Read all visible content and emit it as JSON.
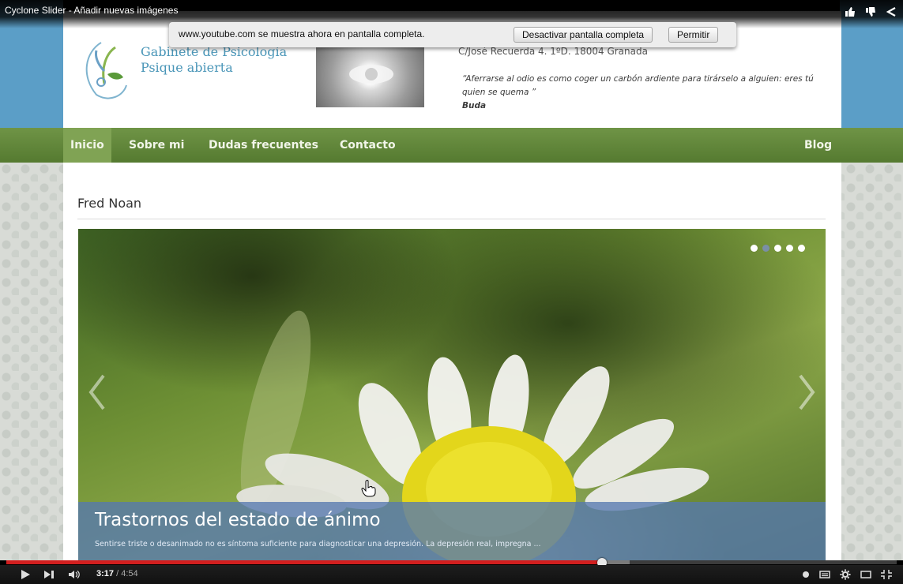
{
  "video": {
    "title": "Cyclone Slider - Añadir nuevas imágenes",
    "current_time": "3:17",
    "separator": "/",
    "duration": "4:54",
    "progress": 0.669,
    "loaded": 0.7
  },
  "fullscreen_notice": {
    "message": "www.youtube.com se muestra ahora en pantalla completa.",
    "exit_label": "Desactivar pantalla completa",
    "allow_label": "Permitir"
  },
  "site": {
    "logo_line1": "Gabinete de Psicología",
    "logo_line2": "Psique abierta",
    "address": "C/José Recuerda 4. 1ºD. 18004 Granada",
    "quote": "“Aferrarse al odio es como coger un carbón ardiente para tirárselo a alguien: eres tú quien se quema ”",
    "quote_author": "Buda"
  },
  "nav": {
    "items": [
      "Inicio",
      "Sobre mi",
      "Dudas frecuentes",
      "Contacto"
    ],
    "right_item": "Blog",
    "active_index": 0
  },
  "post": {
    "title": "Fred Noan"
  },
  "slider": {
    "caption_title": "Trastornos del estado de ánimo",
    "caption_text": "Sentirse triste o desanimado no es síntoma suficiente para diagnosticar una depresión. La depresión real, impregna ...",
    "slide_count": 5,
    "active_slide": 1
  },
  "colors": {
    "nav_green": "#6f9446",
    "progress_red": "#d21f1f",
    "caption_blue": "#5678b0",
    "logo_blue": "#4a96b8"
  }
}
